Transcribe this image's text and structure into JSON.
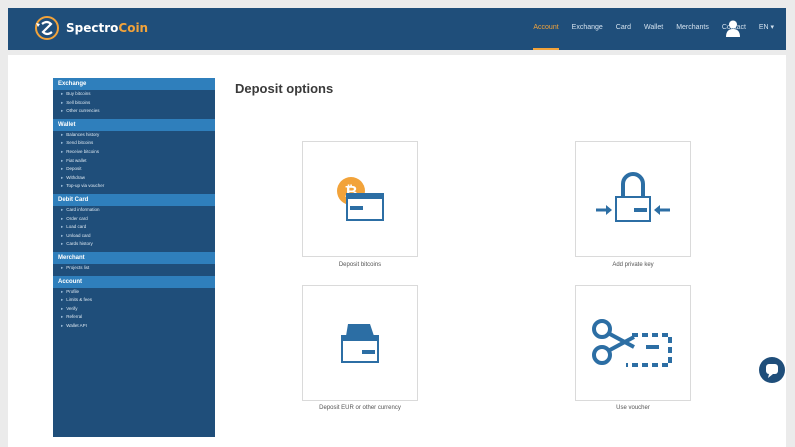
{
  "brand": {
    "name_part1": "Spectro",
    "name_part2": "Coin"
  },
  "nav": {
    "items": [
      "Account",
      "Exchange",
      "Card",
      "Wallet",
      "Merchants",
      "Contact"
    ],
    "active": "Account",
    "language": "EN ▾"
  },
  "sidebar": {
    "sections": [
      {
        "title": "Exchange",
        "items": [
          "Buy bitcoins",
          "Sell bitcoins",
          "Other currencies"
        ]
      },
      {
        "title": "Wallet",
        "items": [
          "Balances history",
          "Send bitcoins",
          "Receive bitcoins",
          "Fiat wallet",
          "Deposit",
          "Withdraw",
          "Top-up via voucher"
        ]
      },
      {
        "title": "Debit Card",
        "items": [
          "Card information",
          "Order card",
          "Load card",
          "Unload card",
          "Cards history"
        ]
      },
      {
        "title": "Merchant",
        "items": [
          "Projects list"
        ]
      },
      {
        "title": "Account",
        "items": [
          "Profile",
          "Limits & fees",
          "Verify",
          "Referral",
          "Wallet API"
        ]
      }
    ]
  },
  "page": {
    "title": "Deposit options"
  },
  "options": [
    {
      "label": "Deposit bitcoins",
      "icon": "bitcoin-wallet-icon"
    },
    {
      "label": "Add private key",
      "icon": "private-key-lock-icon"
    },
    {
      "label": "Deposit EUR or other currency",
      "icon": "currency-wallet-icon"
    },
    {
      "label": "Use voucher",
      "icon": "voucher-scissors-icon"
    }
  ],
  "colors": {
    "navbar": "#1f4e7a",
    "accent": "#f2a33a",
    "section_header": "#2f7fbc"
  }
}
